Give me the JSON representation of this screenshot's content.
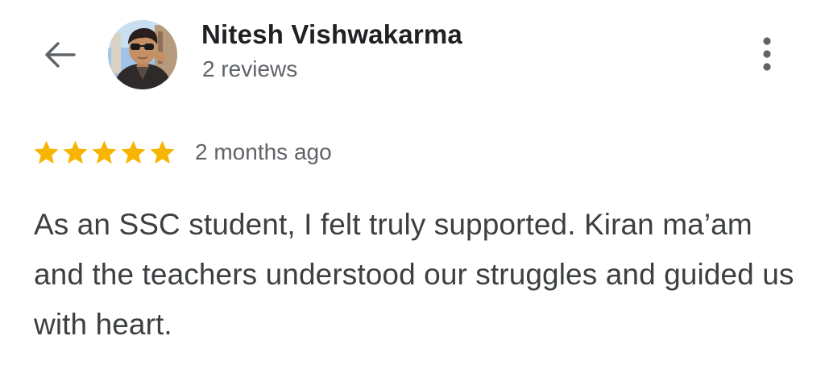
{
  "header": {
    "back_icon": "arrow-back-icon",
    "user_name": "Nitesh Vishwakarma",
    "review_count": "2 reviews",
    "more_icon": "more-vertical-icon"
  },
  "review": {
    "rating": 5,
    "rating_max": 5,
    "time_ago": "2 months ago",
    "text": "As an SSC student, I felt truly supported. Kiran ma’am and the teachers understood our struggles and guided us with heart."
  },
  "colors": {
    "star": "#f7b500",
    "name": "#202124",
    "secondary_text": "#5f6368",
    "body_text": "#3c4043",
    "icon": "#5f6368"
  }
}
